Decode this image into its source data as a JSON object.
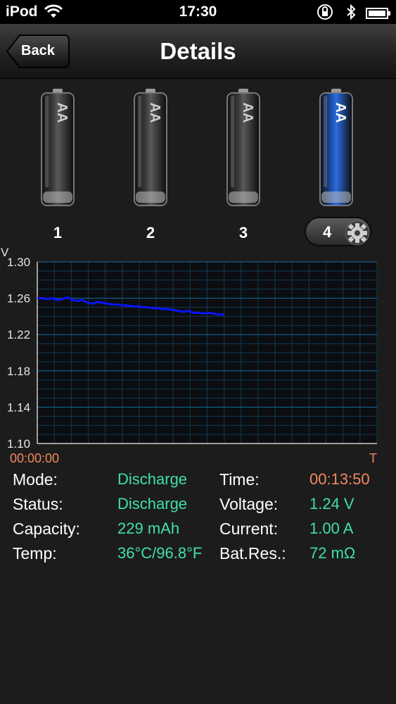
{
  "status_bar": {
    "carrier": "iPod",
    "time": "17:30",
    "icons": [
      "wifi-icon",
      "orientation-lock-icon",
      "bluetooth-icon",
      "battery-icon"
    ]
  },
  "nav": {
    "back_label": "Back",
    "title": "Details"
  },
  "batteries": [
    {
      "label": "1",
      "type": "AA",
      "selected": false
    },
    {
      "label": "2",
      "type": "AA",
      "selected": false
    },
    {
      "label": "3",
      "type": "AA",
      "selected": false
    },
    {
      "label": "4",
      "type": "AA",
      "selected": true
    }
  ],
  "colors": {
    "battery_idle": "#3a3a3a",
    "battery_active": "#1c4fa8",
    "value_green": "#3fe0a4",
    "value_orange": "#f2895d",
    "trace": "#0a14ff",
    "grid": "#123a56"
  },
  "chart_data": {
    "type": "line",
    "ylabel": "V",
    "xlabel": "T",
    "x_start_label": "00:00:00",
    "ylim": [
      1.1,
      1.3
    ],
    "yticks": [
      "1.30",
      "1.26",
      "1.22",
      "1.18",
      "1.14",
      "1.10"
    ],
    "grid": true,
    "series": [
      {
        "values": [
          1.26,
          1.26,
          1.259,
          1.26,
          1.258,
          1.259,
          1.261,
          1.258,
          1.257,
          1.258,
          1.255,
          1.254,
          1.256,
          1.255,
          1.254,
          1.253,
          1.253,
          1.252,
          1.252,
          1.251,
          1.251,
          1.25,
          1.25,
          1.249,
          1.249,
          1.248,
          1.248,
          1.247,
          1.246,
          1.245,
          1.246,
          1.244,
          1.244,
          1.243,
          1.244,
          1.243,
          1.242,
          1.242
        ]
      }
    ]
  },
  "metrics": {
    "mode_label": "Mode:",
    "mode_value": "Discharge",
    "status_label": "Status:",
    "status_value": "Discharge",
    "capacity_label": "Capacity:",
    "capacity_value": "229 mAh",
    "temp_label": "Temp:",
    "temp_value": "36°C/96.8°F",
    "time_label": "Time:",
    "time_value": "00:13:50",
    "voltage_label": "Voltage:",
    "voltage_value": "1.24 V",
    "current_label": "Current:",
    "current_value": "1.00 A",
    "res_label": "Bat.Res.:",
    "res_value": "72 mΩ"
  }
}
